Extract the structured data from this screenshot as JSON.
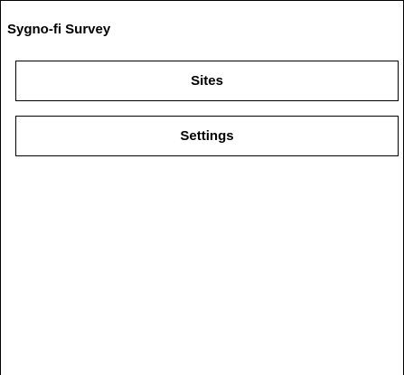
{
  "app": {
    "title": "Sygno-fi Survey"
  },
  "menu": {
    "items": [
      {
        "label": "Sites"
      },
      {
        "label": "Settings"
      }
    ]
  },
  "colors": {
    "background": "#ffffff",
    "border": "#000000",
    "text": "#000000"
  }
}
